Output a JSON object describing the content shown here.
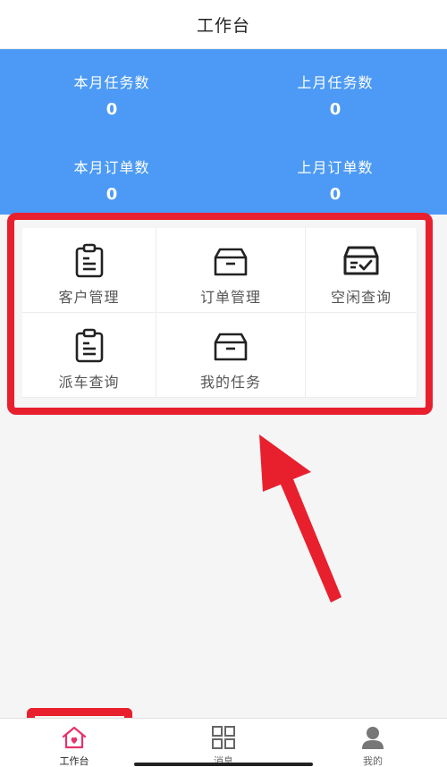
{
  "header": {
    "title": "工作台"
  },
  "stats": [
    {
      "label": "本月任务数",
      "value": "0"
    },
    {
      "label": "上月任务数",
      "value": "0"
    },
    {
      "label": "本月订单数",
      "value": "0"
    },
    {
      "label": "上月订单数",
      "value": "0"
    }
  ],
  "menu": [
    {
      "label": "客户管理",
      "icon": "clipboard-icon"
    },
    {
      "label": "订单管理",
      "icon": "box-icon"
    },
    {
      "label": "空闲查询",
      "icon": "inbox-check-icon"
    },
    {
      "label": "派车查询",
      "icon": "clipboard-icon"
    },
    {
      "label": "我的任务",
      "icon": "box-icon"
    }
  ],
  "tabbar": [
    {
      "label": "工作台",
      "icon": "home-icon",
      "active": true
    },
    {
      "label": "消息",
      "icon": "grid-icon",
      "active": false
    },
    {
      "label": "我的",
      "icon": "person-icon",
      "active": false
    }
  ],
  "colors": {
    "primary_blue": "#4c9af5",
    "annotation_red": "#e8202e",
    "active_tab": "#e8316b"
  }
}
